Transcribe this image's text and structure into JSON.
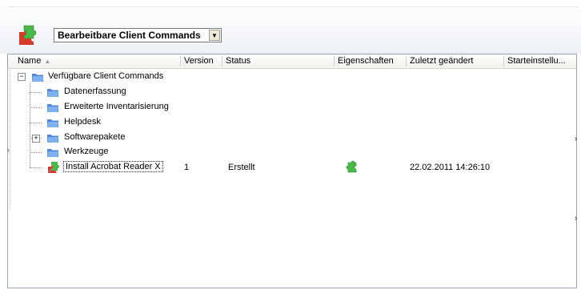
{
  "toolbar": {
    "dropdown_value": "Bearbeitbare Client Commands"
  },
  "columns": [
    "Name",
    "Version",
    "Status",
    "Eigenschaften",
    "Zuletzt geändert",
    "Starteinstellu..."
  ],
  "tree": {
    "root": "Verfügbare Client Commands",
    "children": [
      "Datenerfassung",
      "Erweiterte Inventarisierung",
      "Helpdesk",
      "Softwarepakete",
      "Werkzeuge"
    ]
  },
  "item": {
    "name": "Install Acrobat Reader X",
    "version": "1",
    "status": "Erstellt",
    "modified": "22.02.2011 14:26:10"
  },
  "icons": {
    "app": "puzzle-icon",
    "folder": "folder-icon",
    "command": "command-puzzle-icon",
    "properties": "green-puzzle-icon"
  },
  "colors": {
    "folder": "#4f86d9",
    "puzzle_green": "#48b848",
    "puzzle_red": "#d83a2a"
  }
}
